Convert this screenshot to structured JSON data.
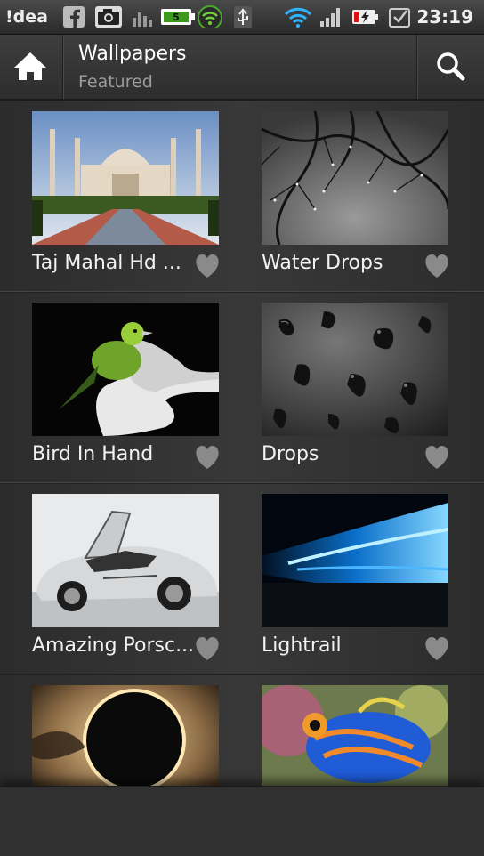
{
  "status": {
    "carrier": "!dea",
    "time": "23:19",
    "notification_icons": [
      "facebook-icon",
      "camera-icon",
      "chart-icon",
      "battery-app-icon",
      "wifi-lock-icon",
      "usb-icon"
    ],
    "system_icons": [
      "wifi-icon",
      "signal-icon",
      "battery-charging-icon",
      "checkbox-icon"
    ]
  },
  "actionbar": {
    "title": "Wallpapers",
    "subtitle": "Featured"
  },
  "colors": {
    "background": "#2f2f2f",
    "heart": "#8a8a8a"
  },
  "wallpapers": [
    {
      "title": "Taj Mahal Hd ...",
      "image": "taj-mahal-image"
    },
    {
      "title": "Water Drops",
      "image": "water-drops-image"
    },
    {
      "title": "Bird In Hand",
      "image": "bird-in-hand-image"
    },
    {
      "title": "Drops",
      "image": "drops-image"
    },
    {
      "title": "Amazing Porsc...",
      "image": "porsche-image"
    },
    {
      "title": "Lightrail",
      "image": "lightrail-image"
    },
    {
      "title": "",
      "image": "eclipse-image"
    },
    {
      "title": "",
      "image": "mandarin-fish-image"
    }
  ]
}
